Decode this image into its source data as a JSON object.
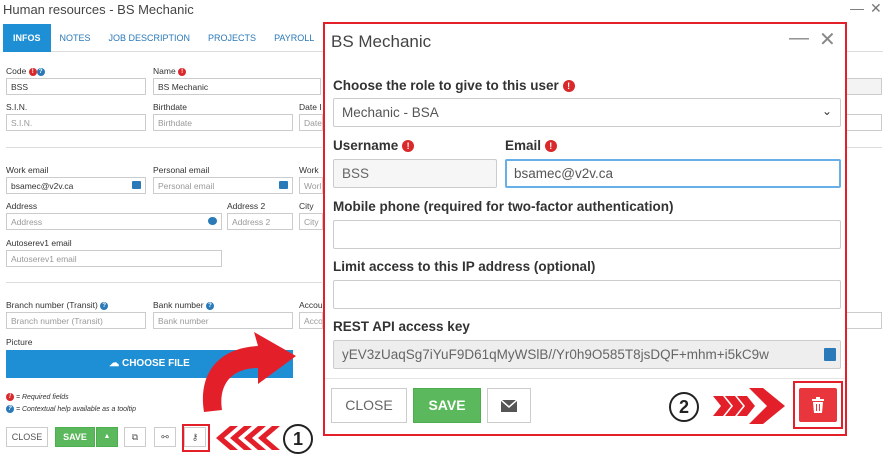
{
  "window": {
    "title": "Human resources - BS Mechanic",
    "minimize": "—",
    "close": "✕"
  },
  "tabs": [
    "INFOS",
    "NOTES",
    "JOB DESCRIPTION",
    "PROJECTS",
    "PAYROLL"
  ],
  "form": {
    "code_label": "Code",
    "code_value": "BSS",
    "name_label": "Name",
    "name_value": "BS Mechanic",
    "date_label": "Date I",
    "date_placeholder": "Date",
    "sin_label": "S.I.N.",
    "sin_placeholder": "S.I.N.",
    "birthdate_label": "Birthdate",
    "birthdate_placeholder": "Birthdate",
    "work_email_label": "Work email",
    "work_email_value": "bsamec@v2v.ca",
    "personal_email_label": "Personal email",
    "personal_email_placeholder": "Personal email",
    "work_label": "Work",
    "work_placeholder": "Worl",
    "address_label": "Address",
    "address_placeholder": "Address",
    "address2_label": "Address 2",
    "address2_placeholder": "Address 2",
    "city_label": "City",
    "city_placeholder": "City",
    "autoserev_label": "Autoserev1 email",
    "autoserev_placeholder": "Autoserev1 email",
    "branch_label": "Branch number (Transit)",
    "branch_placeholder": "Branch number (Transit)",
    "bank_label": "Bank number",
    "bank_placeholder": "Bank number",
    "account_label": "Accou",
    "account_placeholder": "Acco",
    "picture_label": "Picture",
    "choose_file": "CHOOSE FILE",
    "legend_required": "= Required fields",
    "legend_help": "= Contextual help available as a tooltip"
  },
  "bottom_bar": {
    "close": "CLOSE",
    "save": "SAVE",
    "caret": "▲"
  },
  "modal": {
    "title": "BS Mechanic",
    "minimize": "—",
    "close": "✕",
    "role_label": "Choose the role to give to this user",
    "role_value": "Mechanic - BSA",
    "username_label": "Username",
    "username_value": "BSS",
    "email_label": "Email",
    "email_value": "bsamec@v2v.ca",
    "mobile_label": "Mobile phone (required for two-factor authentication)",
    "ip_label": "Limit access to this IP address (optional)",
    "api_label": "REST API access key",
    "api_value": "yEV3zUaqSg7iYuF9D61qMyWSlB//Yr0h9O585T8jsDQF+mhm+i5kC9w",
    "close_button": "CLOSE",
    "save_button": "SAVE"
  },
  "annotations": {
    "step1": "1",
    "step2": "2"
  },
  "colors": {
    "accent": "#1e8fd4",
    "highlight": "#e3202a",
    "save_green": "#5cb85c",
    "delete_red": "#e8363c"
  }
}
